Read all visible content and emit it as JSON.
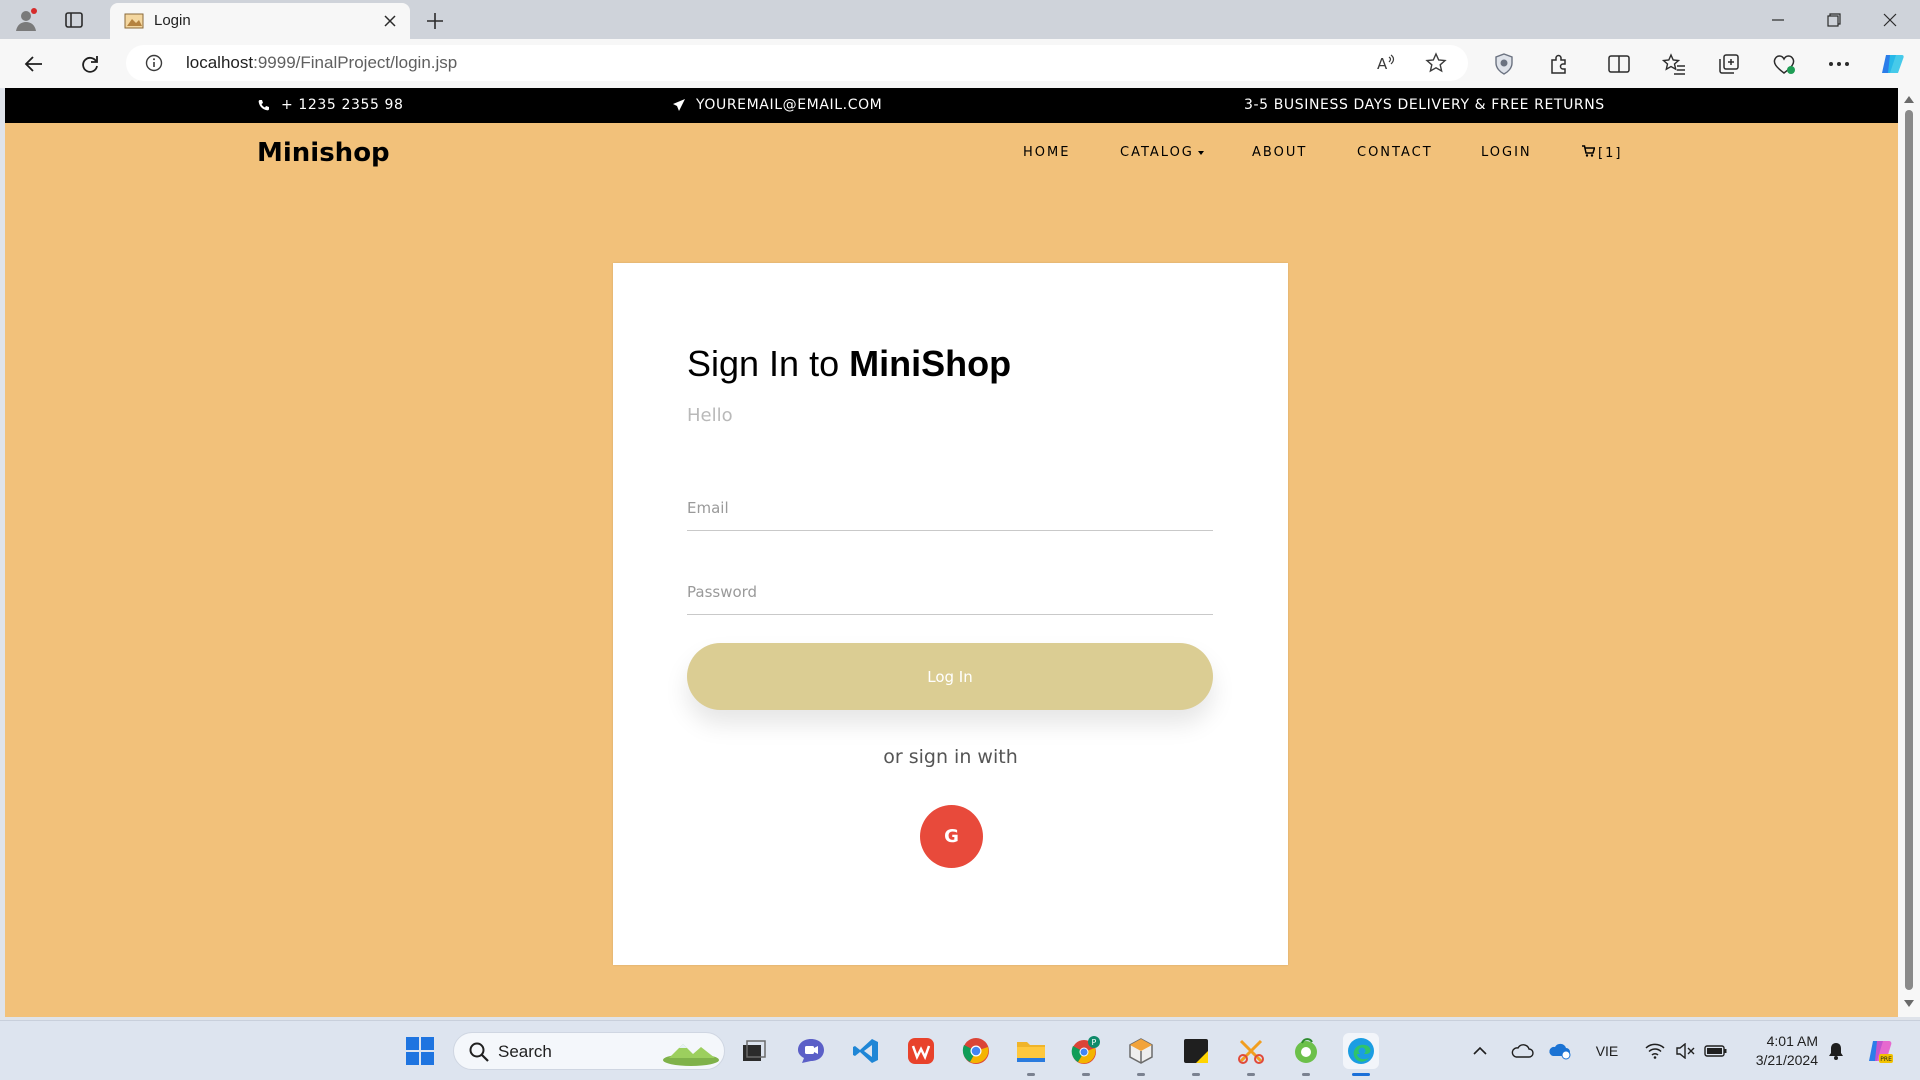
{
  "browser": {
    "tab_title": "Login",
    "url_host": "localhost",
    "url_path": ":9999/FinalProject/login.jsp"
  },
  "site": {
    "topbar": {
      "phone": "+ 1235 2355 98",
      "email": "YOUREMAIL@EMAIL.COM",
      "delivery": "3-5 BUSINESS DAYS DELIVERY & FREE RETURNS"
    },
    "brand": "Minishop",
    "nav": {
      "home": "HOME",
      "catalog": "CATALOG",
      "about": "ABOUT",
      "contact": "CONTACT",
      "login": "LOGIN",
      "cart": "[1]"
    }
  },
  "login": {
    "title_prefix": "Sign In to",
    "title_brand": "MiniShop",
    "subtitle": "Hello",
    "email_placeholder": "Email",
    "password_placeholder": "Password",
    "submit_label": "Log In",
    "alt_text": "or sign in with",
    "google_letter": "G"
  },
  "taskbar": {
    "search_label": "Search",
    "language": "VIE",
    "time": "4:01 AM",
    "date": "3/21/2024"
  },
  "colors": {
    "page_bg": "#f2c17a",
    "login_button": "#dbcd93",
    "google_button": "#e84a3b",
    "topbar_bg": "#000000"
  }
}
